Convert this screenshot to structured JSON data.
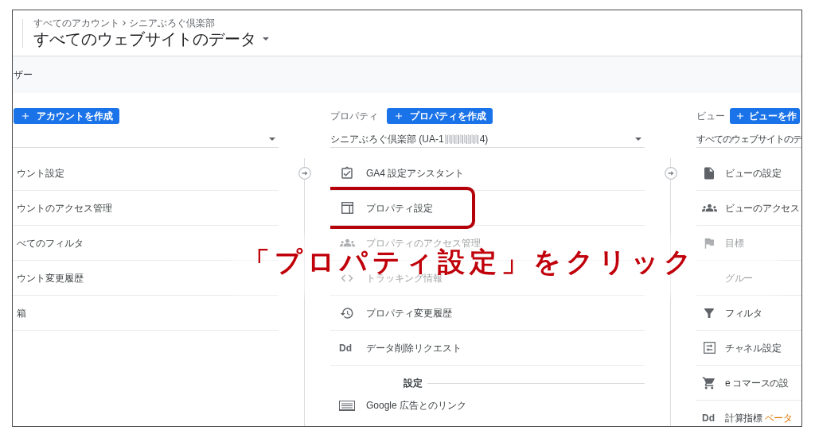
{
  "header": {
    "breadcrumb": [
      "すべてのアカウント",
      "シニアぶろぐ倶楽部"
    ],
    "title": "すべてのウェブサイトのデータ"
  },
  "user_bar": {
    "label": "ザー"
  },
  "columns": [
    {
      "create_button": "アカウントを作成",
      "selector": {
        "caret": true
      },
      "items": [
        {
          "kind": "item",
          "label": "ウント設定",
          "highlighted": false
        },
        {
          "kind": "item",
          "label": "ウントのアクセス管理",
          "highlighted": false
        },
        {
          "kind": "item",
          "label": "べてのフィルタ",
          "highlighted": false
        },
        {
          "kind": "item",
          "label": "ウント変更履歴",
          "highlighted": false
        },
        {
          "kind": "item",
          "label": "箱",
          "highlighted": false
        }
      ]
    },
    {
      "label": "プロパティ",
      "create_button": "プロパティを作成",
      "selector": {
        "value": "シニアぶろぐ倶楽部 (UA-1",
        "redacted": true,
        "value_end": "4)",
        "caret": true
      },
      "items": [
        {
          "kind": "item",
          "label": "GA4 設定アシスタント",
          "highlighted": false
        },
        {
          "kind": "item",
          "label": "プロパティ設定",
          "highlighted": true
        },
        {
          "kind": "item",
          "label": "プロパティのアクセス管理",
          "highlighted": false
        },
        {
          "kind": "item",
          "label": "トラッキング情報",
          "highlighted": false
        },
        {
          "kind": "item",
          "label": "プロパティ変更履歴",
          "highlighted": false
        },
        {
          "kind": "item",
          "icon_text": "Dd",
          "label": "データ削除リクエスト",
          "highlighted": false
        },
        {
          "kind": "heading",
          "label": "設定"
        },
        {
          "kind": "item",
          "label": "Google 広告とのリンク",
          "highlighted": false
        }
      ]
    },
    {
      "label": "ビュー",
      "create_button": "ビューを作",
      "selector": {
        "value": "すべてのウェブサイトのデ",
        "caret": false
      },
      "items": [
        {
          "kind": "item",
          "label": "ビューの設定",
          "highlighted": false
        },
        {
          "kind": "item",
          "label": "ビューのアクセス",
          "highlighted": false
        },
        {
          "kind": "item",
          "label": "目標",
          "highlighted": false
        },
        {
          "kind": "item",
          "label": "グルー",
          "highlighted": false
        },
        {
          "kind": "item",
          "label": "フィルタ",
          "highlighted": false
        },
        {
          "kind": "item",
          "label": "チャネル設定",
          "highlighted": false
        },
        {
          "kind": "item",
          "label": "e コマースの設",
          "highlighted": false
        },
        {
          "kind": "item",
          "icon_text": "Dd",
          "label": "計算指標",
          "badge": "ベータ",
          "highlighted": false
        }
      ]
    }
  ],
  "annotation": {
    "text": "「プロパティ設定」をクリック"
  }
}
